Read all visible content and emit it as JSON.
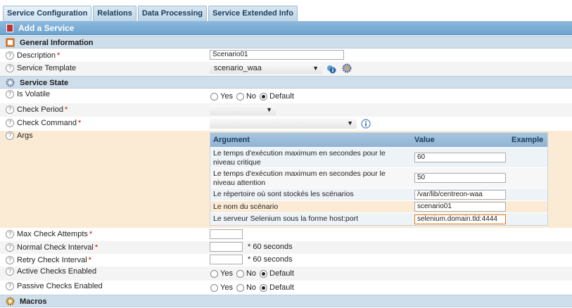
{
  "tabs": [
    {
      "label": "Service Configuration"
    },
    {
      "label": "Relations"
    },
    {
      "label": "Data Processing"
    },
    {
      "label": "Service Extended Info"
    }
  ],
  "header": {
    "title": "Add a Service"
  },
  "general": {
    "section_title": "General Information",
    "description": {
      "label": "Description",
      "value": "Scenario01"
    },
    "template": {
      "label": "Service Template",
      "value": "scenario_waa"
    }
  },
  "state": {
    "section_title": "Service State",
    "is_volatile": {
      "label": "Is Volatile"
    },
    "check_period": {
      "label": "Check Period"
    },
    "check_command": {
      "label": "Check Command"
    },
    "args": {
      "label": "Args",
      "columns": [
        "Argument",
        "Value",
        "Example"
      ],
      "rows": [
        {
          "argument": "Le temps d'exécution maximum en secondes pour le niveau critique",
          "value": "60"
        },
        {
          "argument": "Le temps d'exécution maximum en secondes pour le niveau attention",
          "value": "50"
        },
        {
          "argument": "Le répertoire où sont stockés les scénarios",
          "value": "/var/lib/centreon-waa"
        },
        {
          "argument": "Le nom du scénario",
          "value": "scenario01"
        },
        {
          "argument": "Le serveur Selenium sous la forme host:port",
          "value": "selenium.domain.tld:4444"
        }
      ]
    },
    "max_check_attempts": {
      "label": "Max Check Attempts"
    },
    "normal_interval": {
      "label": "Normal Check Interval",
      "suffix": "* 60 seconds"
    },
    "retry_interval": {
      "label": "Retry Check Interval",
      "suffix": "* 60 seconds"
    },
    "active_checks": {
      "label": "Active Checks Enabled"
    },
    "passive_checks": {
      "label": "Passive Checks Enabled"
    }
  },
  "radio_options": {
    "yes": "Yes",
    "no": "No",
    "default": "Default"
  },
  "macros": {
    "section_title": "Macros"
  },
  "required_mark": "*",
  "help_glyph": "?"
}
